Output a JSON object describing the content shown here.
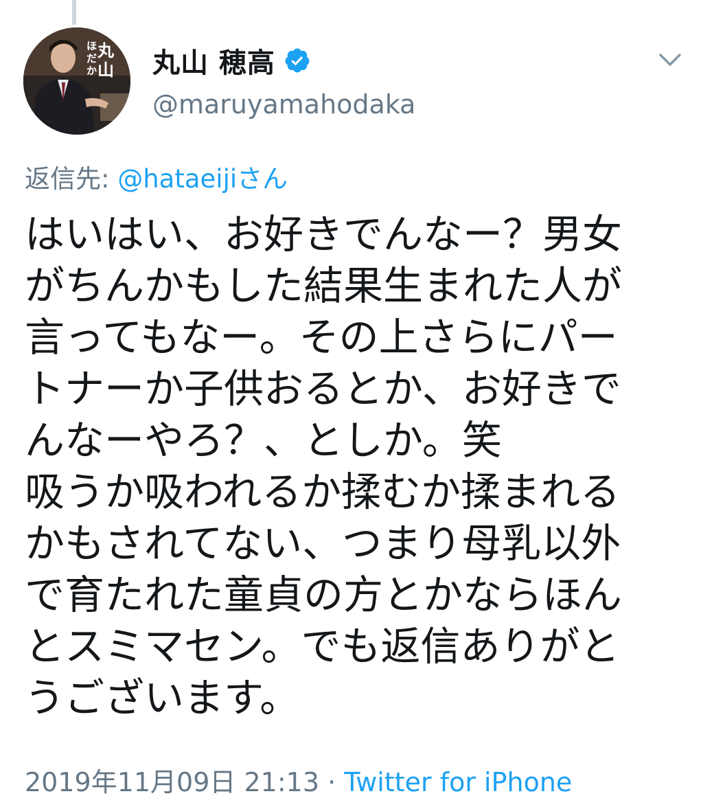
{
  "author": {
    "display_name": "丸山 穂高",
    "handle": "@maruyamahodaka",
    "verified": true,
    "avatar_text": [
      "丸",
      "山",
      "ほ",
      "だ",
      "か"
    ]
  },
  "reply": {
    "prefix": "返信先: ",
    "mention": "@hataeiji",
    "suffix": "さん"
  },
  "tweet": {
    "lines": [
      "はいはい、お好きでんなー？男女",
      "がちんかもした結果生まれた人が",
      "言ってもなー。その上さらにパー",
      "トナーか子供おるとか、お好きで",
      "んなーやろ？、としか。笑",
      "吸うか吸われるか揉むか揉まれる",
      "かもされてない、つまり母乳以外",
      "で育たれた童貞の方とかならほん",
      "とスミマセン。でも返信ありがと",
      "うございます。"
    ]
  },
  "meta": {
    "timestamp": "2019年11月09日 21:13",
    "separator": " · ",
    "source": "Twitter for iPhone"
  },
  "colors": {
    "text": "#14171a",
    "secondary": "#657786",
    "accent": "#1da1f2",
    "thread_line": "#ccd6dd"
  },
  "icons": {
    "verified": "verified-badge-icon",
    "menu": "chevron-down-icon"
  }
}
